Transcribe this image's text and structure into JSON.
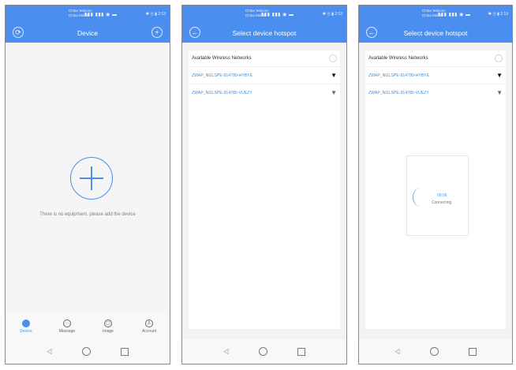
{
  "phones": [
    {
      "title": "Device",
      "empty_text": "There is no equipment, please add the device",
      "tabs": [
        {
          "label": "Device",
          "icon": "device-icon",
          "active": true
        },
        {
          "label": "Message",
          "icon": "message-icon",
          "active": false
        },
        {
          "label": "Image",
          "icon": "image-icon",
          "active": false
        },
        {
          "label": "Account",
          "icon": "account-icon",
          "active": false
        }
      ],
      "nav": [
        "back-icon",
        "home-icon",
        "recent-apps-icon"
      ]
    },
    {
      "title": "Select device hotspot",
      "wifi_heading": "Available Wireless Networks",
      "networks": [
        {
          "ssid": "ZWAP_NGLSPE-914780-HYBYE",
          "signal": "strong"
        },
        {
          "ssid": "ZWAP_NGLSPE-914780-VUEZY",
          "signal": "medium"
        }
      ]
    },
    {
      "title": "Select device hotspot",
      "wifi_heading": "Available Wireless Networks",
      "networks": [
        {
          "ssid": "ZWAP_NGLSPE-914780-HYBYE",
          "signal": "strong"
        },
        {
          "ssid": "ZWAP_NGLSPE-914780-VUEZY",
          "signal": "medium"
        }
      ],
      "loading_time": "00:06",
      "loading_text": "Connecting"
    }
  ],
  "colors": {
    "brand": "#4a8ff0",
    "link": "#3c8ee9",
    "background": "#f5f5f5"
  }
}
